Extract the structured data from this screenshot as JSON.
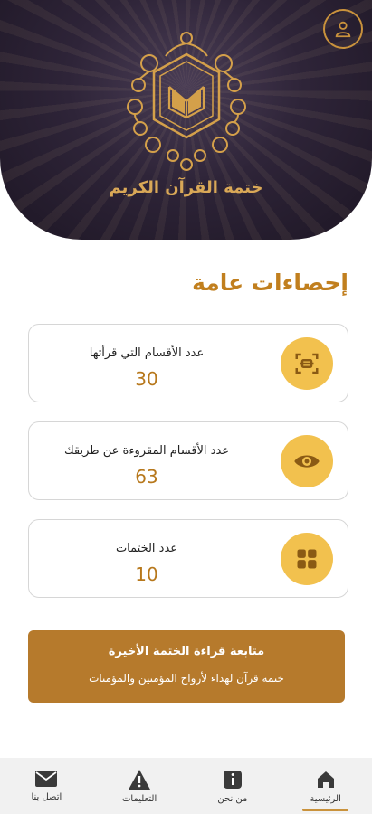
{
  "header": {
    "app_title": "ختمة القرآن الكريم",
    "profile_icon": "user-icon"
  },
  "stats_section": {
    "title": "إحصاءات عامة",
    "cards": [
      {
        "label": "عدد الأقسام التي قرأتها",
        "value": "30",
        "icon": "scan-icon"
      },
      {
        "label": "عدد الأقسام المقروءة عن طريقك",
        "value": "63",
        "icon": "eye-icon"
      },
      {
        "label": "عدد الختمات",
        "value": "10",
        "icon": "grid-icon"
      }
    ]
  },
  "continue_reading": {
    "title": "متابعة قراءة الختمة الأخيرة",
    "subtitle": "ختمة قرآن لهداء لأرواح المؤمنين والمؤمنات"
  },
  "bottom_nav": {
    "items": [
      {
        "label": "الرئيسية",
        "icon": "home-icon",
        "active": true
      },
      {
        "label": "من نحن",
        "icon": "info-icon",
        "active": false
      },
      {
        "label": "التعليمات",
        "icon": "warning-icon",
        "active": false
      },
      {
        "label": "اتصل بنا",
        "icon": "mail-icon",
        "active": false
      }
    ]
  },
  "colors": {
    "accent": "#c9923c",
    "icon_bg": "#f2c14e",
    "button_bg": "#b67a2c",
    "header_bg": "#2e2438"
  }
}
